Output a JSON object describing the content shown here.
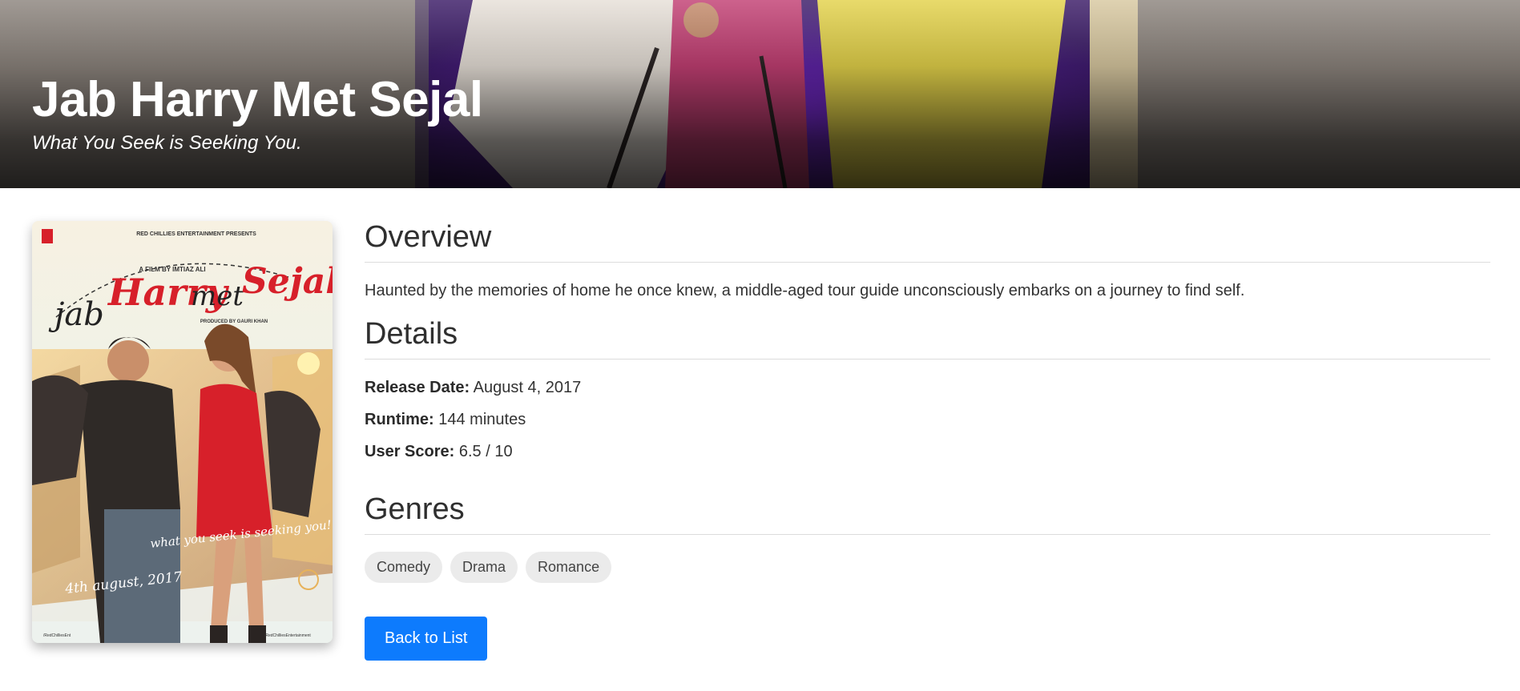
{
  "hero": {
    "title": "Jab Harry Met Sejal",
    "tagline": "What You Seek is Seeking You."
  },
  "poster": {
    "presenter": "RED CHILLIES ENTERTAINMENT PRESENTS",
    "director_credit": "A FILM BY IMTIAZ ALI",
    "title_part_1": "jab",
    "title_part_2": "Harry",
    "title_part_3": "met",
    "title_part_4": "Sejal",
    "producer_credit": "PRODUCED BY GAURI KHAN",
    "tagline": "what you seek is seeking you!",
    "release": "4th august, 2017",
    "social_left": "/RedChilliesEnt",
    "social_right": "/RedChilliesEntertainment"
  },
  "overview": {
    "heading": "Overview",
    "text": "Haunted by the memories of home he once knew, a middle-aged tour guide unconsciously embarks on a journey to find self."
  },
  "details": {
    "heading": "Details",
    "release_label": "Release Date:",
    "release_value": "August 4, 2017",
    "runtime_label": "Runtime:",
    "runtime_value": "144 minutes",
    "score_label": "User Score:",
    "score_value": "6.5 / 10"
  },
  "genres": {
    "heading": "Genres",
    "items": [
      "Comedy",
      "Drama",
      "Romance"
    ]
  },
  "actions": {
    "back_label": "Back to List"
  },
  "colors": {
    "accent": "#0d7bfd",
    "genre_pill": "#ebebeb",
    "poster_red": "#d7202a"
  }
}
